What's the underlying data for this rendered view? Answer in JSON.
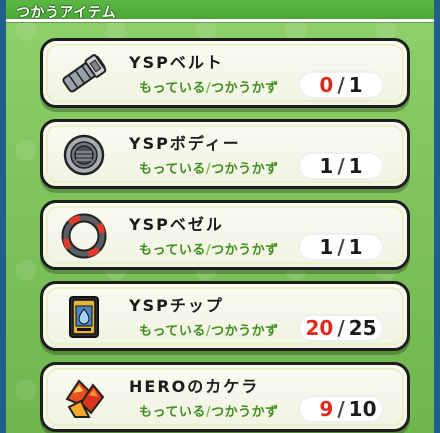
{
  "header": {
    "title": "つかうアイテム"
  },
  "items": [
    {
      "name": "YSPベルト",
      "label_have": "もっている",
      "label_sep": "/",
      "label_need": "つかうかず",
      "have": "0",
      "need": "1",
      "short": true,
      "icon": "belt-icon"
    },
    {
      "name": "YSPボディー",
      "label_have": "もっている",
      "label_sep": "/",
      "label_need": "つかうかず",
      "have": "1",
      "need": "1",
      "short": false,
      "icon": "body-disc-icon"
    },
    {
      "name": "YSPベゼル",
      "label_have": "もっている",
      "label_sep": "/",
      "label_need": "つかうかず",
      "have": "1",
      "need": "1",
      "short": false,
      "icon": "bezel-ring-icon"
    },
    {
      "name": "YSPチップ",
      "label_have": "もっている",
      "label_sep": "/",
      "label_need": "つかうかず",
      "have": "20",
      "need": "25",
      "short": true,
      "icon": "chip-card-icon"
    },
    {
      "name": "HEROのカケラ",
      "label_have": "もっている",
      "label_sep": "/",
      "label_need": "つかうかず",
      "have": "9",
      "need": "10",
      "short": true,
      "icon": "hero-fragment-icon"
    }
  ],
  "colors": {
    "short_red": "#e02a1c",
    "label_green": "#3f8f1e",
    "background_green": "#7cc15a",
    "frame_blue": "#1f5f8a"
  }
}
